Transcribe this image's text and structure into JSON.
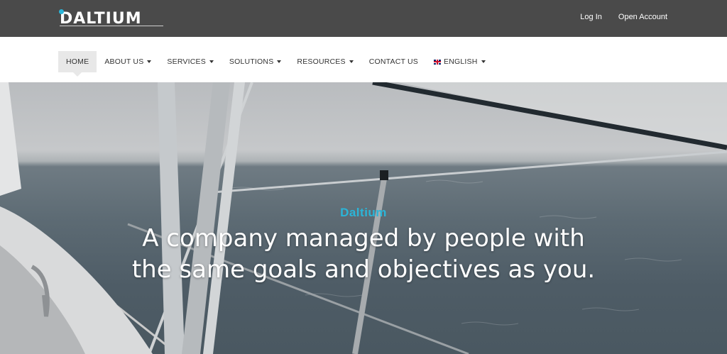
{
  "colors": {
    "topbar_bg": "#4a4a4a",
    "accent": "#2bb5d8"
  },
  "logo": {
    "text": "DALTIUM"
  },
  "top_links": [
    {
      "label": "Log In"
    },
    {
      "label": "Open Account"
    }
  ],
  "nav": {
    "items": [
      {
        "label": "HOME",
        "active": true,
        "dropdown": false
      },
      {
        "label": "ABOUT US",
        "dropdown": true
      },
      {
        "label": "SERVICES",
        "dropdown": true
      },
      {
        "label": "SOLUTIONS",
        "dropdown": true
      },
      {
        "label": "RESOURCES",
        "dropdown": true
      },
      {
        "label": "CONTACT US",
        "dropdown": false
      },
      {
        "label": "ENGLISH",
        "dropdown": true,
        "icon": "uk-flag-icon"
      }
    ]
  },
  "hero": {
    "kicker": "Daltium",
    "title_line1": "A company managed by people with",
    "title_line2": "the same goals and objectives as you."
  }
}
